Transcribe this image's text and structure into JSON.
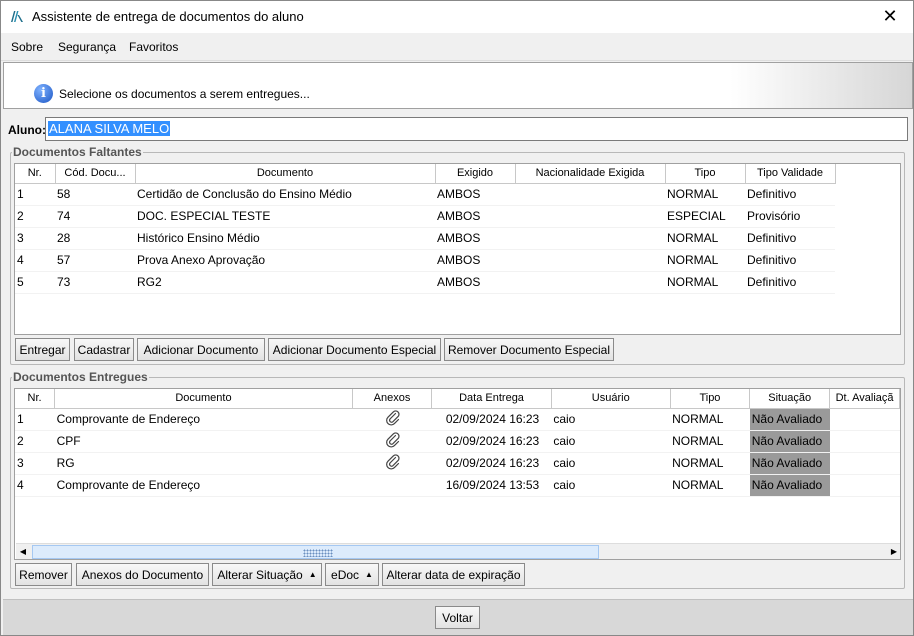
{
  "window": {
    "title": "Assistente de entrega de documentos do aluno"
  },
  "menu": [
    {
      "label": "Sobre"
    },
    {
      "label": "Segurança"
    },
    {
      "label": "Favoritos"
    }
  ],
  "info": {
    "message": "Selecione os documentos a serem entregues..."
  },
  "aluno": {
    "label": "Aluno:",
    "value": "ALANA SILVA MELO"
  },
  "faltantes": {
    "title": "Documentos Faltantes",
    "columns": [
      "Nr.",
      "Cód. Docu...",
      "Documento",
      "Exigido",
      "Nacionalidade Exigida",
      "Tipo",
      "Tipo Validade"
    ],
    "rows": [
      [
        "1",
        "58",
        "Certidão de Conclusão do Ensino Médio",
        "AMBOS",
        "",
        "NORMAL",
        "Definitivo"
      ],
      [
        "2",
        "74",
        "DOC. ESPECIAL TESTE",
        "AMBOS",
        "",
        "ESPECIAL",
        "Provisório"
      ],
      [
        "3",
        "28",
        "Histórico Ensino Médio",
        "AMBOS",
        "",
        "NORMAL",
        "Definitivo"
      ],
      [
        "4",
        "57",
        "Prova Anexo Aprovação",
        "AMBOS",
        "",
        "NORMAL",
        "Definitivo"
      ],
      [
        "5",
        "73",
        "RG2",
        "AMBOS",
        "",
        "NORMAL",
        "Definitivo"
      ]
    ],
    "buttons": {
      "entregar": "Entregar",
      "cadastrar": "Cadastrar",
      "adicionar": "Adicionar Documento",
      "adicionar_especial": "Adicionar Documento Especial",
      "remover_especial": "Remover Documento Especial"
    }
  },
  "entregues": {
    "title": "Documentos Entregues",
    "columns": [
      "Nr.",
      "Documento",
      "Anexos",
      "Data Entrega",
      "Usuário",
      "Tipo",
      "Situação",
      "Dt. Avaliaçã"
    ],
    "rows": [
      {
        "nr": "1",
        "documento": "Comprovante de Endereço",
        "anexo": true,
        "data": "02/09/2024 16:23",
        "usuario": "caio",
        "tipo": "NORMAL",
        "situacao": "Não Avaliado",
        "dt_avaliacao": ""
      },
      {
        "nr": "2",
        "documento": "CPF",
        "anexo": true,
        "data": "02/09/2024 16:23",
        "usuario": "caio",
        "tipo": "NORMAL",
        "situacao": "Não Avaliado",
        "dt_avaliacao": ""
      },
      {
        "nr": "3",
        "documento": "RG",
        "anexo": true,
        "data": "02/09/2024 16:23",
        "usuario": "caio",
        "tipo": "NORMAL",
        "situacao": "Não Avaliado",
        "dt_avaliacao": ""
      },
      {
        "nr": "4",
        "documento": "Comprovante de Endereço",
        "anexo": false,
        "data": "16/09/2024 13:53",
        "usuario": "caio",
        "tipo": "NORMAL",
        "situacao": "Não Avaliado",
        "dt_avaliacao": ""
      }
    ],
    "buttons": {
      "remover": "Remover",
      "anexos": "Anexos do Documento",
      "alterar_situacao": "Alterar Situação",
      "edoc": "eDoc",
      "alterar_data": "Alterar data de expiração"
    }
  },
  "footer": {
    "voltar": "Voltar"
  },
  "icons": {
    "app": "app-logo-icon",
    "close": "close-icon",
    "info": "info-icon",
    "attachment": "paperclip-icon"
  },
  "colors": {
    "selection": "#3390ff",
    "status_bg": "#9a9a9a",
    "info_blue": "#1a55c4"
  }
}
